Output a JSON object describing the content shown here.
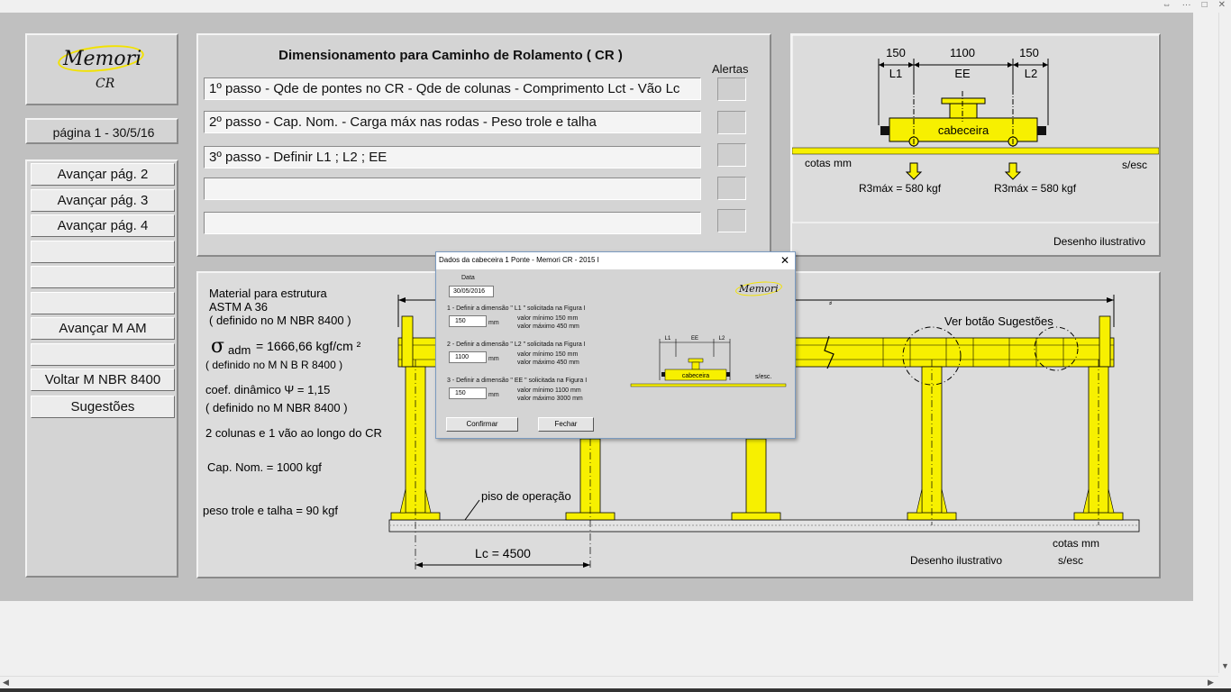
{
  "logo": {
    "name": "Memori",
    "sub": "CR"
  },
  "page_label": "página 1 -   30/5/16",
  "nav": [
    "Avançar pág. 2",
    "Avançar pág. 3",
    "Avançar pág. 4",
    "",
    "",
    "",
    "Avançar M AM",
    "",
    "Voltar M  NBR  8400",
    "Sugestões"
  ],
  "steps": {
    "title": "Dimensionamento para Caminho de Rolamento ( CR )",
    "alertas_label": "Alertas",
    "items": [
      "1º passo - Qde de pontes no CR - Qde de colunas - Comprimento Lct - Vão Lc",
      "2º passo - Cap. Nom. - Carga máx nas rodas - Peso trole e talha",
      "3º passo - Definir L1 ; L2 ; EE",
      "",
      ""
    ]
  },
  "top_drawing": {
    "dim_l1": "150",
    "dim_ee": "1100",
    "dim_l2": "150",
    "lbl_l1": "L1",
    "lbl_ee": "EE",
    "lbl_l2": "L2",
    "cabeceira": "cabeceira",
    "cotas": "cotas mm",
    "sesc": "s/esc",
    "r1": "R3máx = 580 kgf",
    "r2": "R3máx = 580 kgf",
    "caption": "Desenho ilustrativo"
  },
  "main_drawing": {
    "material_1": "Material para estrutura",
    "material_2": "ASTM A 36",
    "material_3": "( definido no M NBR 8400 )",
    "sigma_sym": "σ",
    "sigma_sub": "adm",
    "sigma_val": "= 1666,66 kgf/cm ²",
    "sigma_note": "( definido no M N B R 8400 )",
    "coef": "coef. dinâmico Ψ = 1,15",
    "coef_note": "( definido no M NBR 8400 )",
    "colunas": "2 colunas e 1 vão ao longo do CR",
    "cap": "Cap. Nom. = 1000 kgf",
    "peso": "peso trole e talha = 90 kgf",
    "piso": "piso de operação",
    "ver_botao": "Ver botão Sugestões",
    "lc": "Lc = 4500",
    "cotas": "cotas mm",
    "sesc": "s/esc",
    "caption": "Desenho ilustrativo"
  },
  "dialog": {
    "title": "Dados da cabeceira 1 Ponte - Memori CR - 2015 I",
    "data_label": "Data",
    "data_value": "30/05/2016",
    "logo": "Memori",
    "f1_label": "1 - Definir a dimensão \" L1 \"  solicitada na Figura I",
    "f1_value": "150",
    "f1_unit": "mm",
    "f1_min": "valor mínimo    150 mm",
    "f1_max": "valor máximo   450 mm",
    "f2_label": "2 - Definir a dimensão \" L2 \"  solicitada na Figura I",
    "f2_value": "1100",
    "f2_unit": "mm",
    "f2_min": "valor mínimo    150 mm",
    "f2_max": "valor máximo   450 mm",
    "f3_label": "3 - Definir a dimensão \" EE \"  solicitada na Figura I",
    "f3_value": "150",
    "f3_unit": "mm",
    "f3_min": "valor mínimo    1100 mm",
    "f3_max": "valor máximo   3000 mm",
    "figura": "Figura I",
    "fig_l1": "L1",
    "fig_ee": "EE",
    "fig_l2": "L2",
    "fig_cabeceira": "cabeceira",
    "fig_sesc": "s/esc.",
    "confirm": "Confirmar",
    "close": "Fechar"
  },
  "colors": {
    "yellow": "#f7f000",
    "sheet": "#c0c0c0",
    "panel": "#d4d4d4"
  }
}
